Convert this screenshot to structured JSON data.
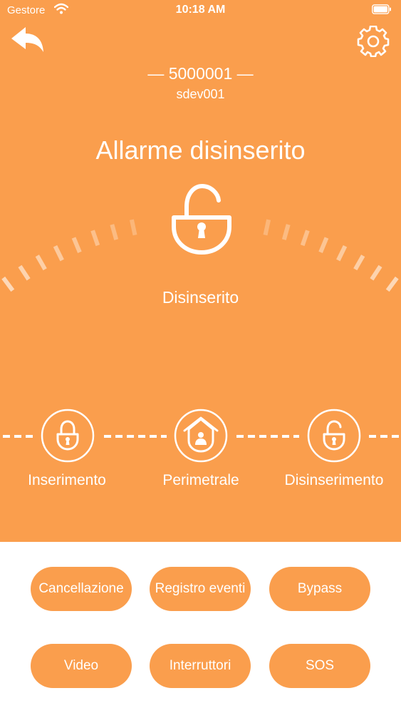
{
  "colors": {
    "accent": "#fa9e4d",
    "foreground": "#ffffff"
  },
  "status_bar": {
    "carrier": "Gestore",
    "time": "10:18 AM"
  },
  "header": {
    "back_icon": "back-arrow-icon",
    "settings_icon": "gear-icon",
    "device_id": "— 5000001 —",
    "device_name": "sdev001"
  },
  "alarm": {
    "title": "Allarme disinserito",
    "state_label": "Disinserito",
    "state_icon": "unlocked-padlock-icon"
  },
  "modes": [
    {
      "label": "Inserimento",
      "icon": "locked-padlock-icon"
    },
    {
      "label": "Perimetrale",
      "icon": "home-shield-icon"
    },
    {
      "label": "Disinserimento",
      "icon": "unlocked-padlock-icon"
    }
  ],
  "actions": [
    {
      "label": "Cancellazione"
    },
    {
      "label": "Registro eventi"
    },
    {
      "label": "Bypass"
    },
    {
      "label": "Video"
    },
    {
      "label": "Interruttori"
    },
    {
      "label": "SOS"
    }
  ]
}
